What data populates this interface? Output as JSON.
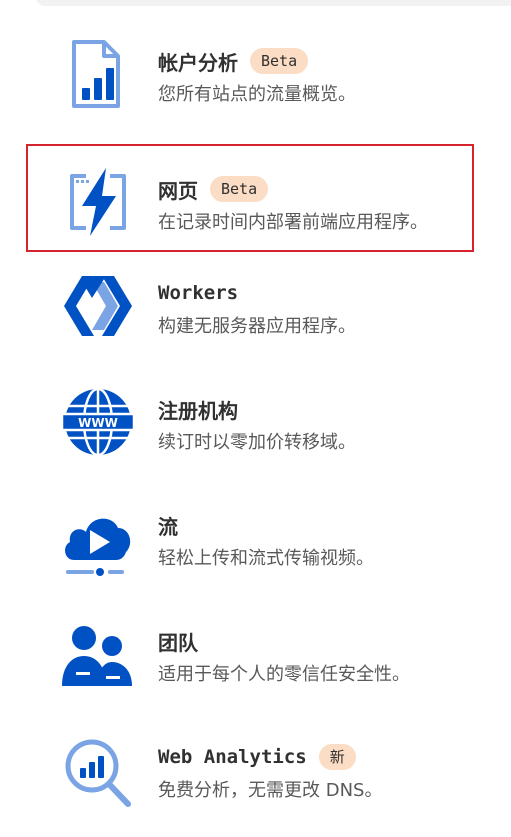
{
  "products": [
    {
      "icon": "analytics-document-icon",
      "title": "帐户分析",
      "badge": "Beta",
      "description": "您所有站点的流量概览。",
      "selected": false
    },
    {
      "icon": "pages-lightning-icon",
      "title": "网页",
      "badge": "Beta",
      "description": "在记录时间内部署前端应用程序。",
      "selected": true
    },
    {
      "icon": "workers-icon",
      "title": "Workers",
      "badge": "",
      "description": "构建无服务器应用程序。",
      "selected": false
    },
    {
      "icon": "globe-www-icon",
      "title": "注册机构",
      "badge": "",
      "description": "续订时以零加价转移域。",
      "selected": false
    },
    {
      "icon": "stream-cloud-play-icon",
      "title": "流",
      "badge": "",
      "description": "轻松上传和流式传输视频。",
      "selected": false
    },
    {
      "icon": "team-people-icon",
      "title": "团队",
      "badge": "",
      "description": "适用于每个人的零信任安全性。",
      "selected": false
    },
    {
      "icon": "web-analytics-magnifier-icon",
      "title": "Web Analytics",
      "badge": "新",
      "description": "免费分析，无需更改 DNS。",
      "selected": false
    }
  ],
  "colors": {
    "primary_blue": "#0051c3",
    "light_blue": "#7aa4e4",
    "selected_border": "#d6242f",
    "badge_bg": "#fbdcc4"
  }
}
